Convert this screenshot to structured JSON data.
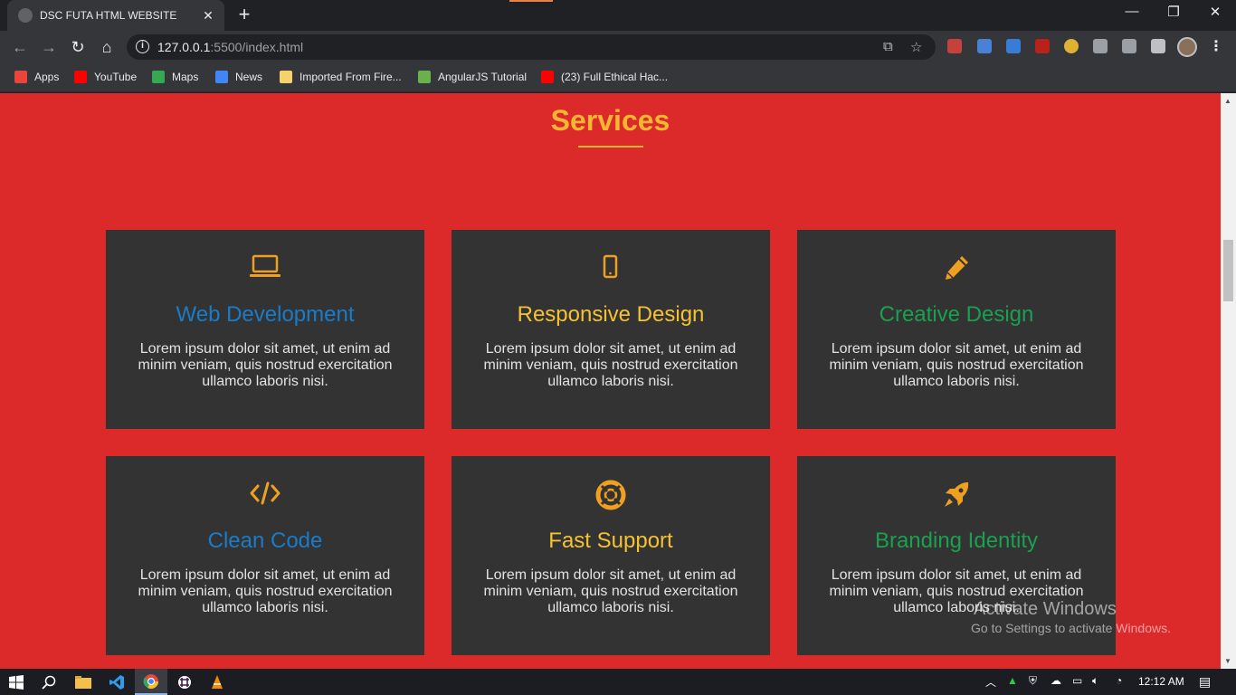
{
  "browser": {
    "tab_title": "DSC FUTA HTML WEBSITE",
    "url_host": "127.0.0.1",
    "url_rest": ":5500/index.html"
  },
  "bookmarks": [
    {
      "label": "Apps",
      "icon": "apps-grid-icon",
      "color": "#e8453c"
    },
    {
      "label": "YouTube",
      "icon": "youtube-icon",
      "color": "#ff0000"
    },
    {
      "label": "Maps",
      "icon": "maps-icon",
      "color": "#34a853"
    },
    {
      "label": "News",
      "icon": "news-icon",
      "color": "#4285f4"
    },
    {
      "label": "Imported From Fire...",
      "icon": "folder-icon",
      "color": "#f6d26b"
    },
    {
      "label": "AngularJS Tutorial",
      "icon": "angularjs-icon",
      "color": "#6ab04c"
    },
    {
      "label": "(23) Full Ethical Hac...",
      "icon": "youtube-icon",
      "color": "#ff0000"
    }
  ],
  "page": {
    "section_title": "Services",
    "cards": [
      {
        "icon": "laptop-icon",
        "title": "Web Development",
        "text": "Lorem ipsum dolor sit amet, ut enim ad minim veniam, quis nostrud exercitation ullamco laboris nisi."
      },
      {
        "icon": "mobile-icon",
        "title": "Responsive Design",
        "text": "Lorem ipsum dolor sit amet, ut enim ad minim veniam, quis nostrud exercitation ullamco laboris nisi."
      },
      {
        "icon": "pencil-icon",
        "title": "Creative Design",
        "text": "Lorem ipsum dolor sit amet, ut enim ad minim veniam, quis nostrud exercitation ullamco laboris nisi."
      },
      {
        "icon": "code-icon",
        "title": "Clean Code",
        "text": "Lorem ipsum dolor sit amet, ut enim ad minim veniam, quis nostrud exercitation ullamco laboris nisi."
      },
      {
        "icon": "lifebuoy-icon",
        "title": "Fast Support",
        "text": "Lorem ipsum dolor sit amet, ut enim ad minim veniam, quis nostrud exercitation ullamco laboris nisi."
      },
      {
        "icon": "rocket-icon",
        "title": "Branding Identity",
        "text": "Lorem ipsum dolor sit amet, ut enim ad minim veniam, quis nostrud exercitation ullamco laboris nisi."
      }
    ],
    "accent_color": "#f5b731",
    "background_color": "#dc2a2a"
  },
  "watermark": {
    "title": "Activate Windows",
    "subtitle": "Go to Settings to activate Windows."
  },
  "taskbar": {
    "clock": "12:12 AM"
  }
}
